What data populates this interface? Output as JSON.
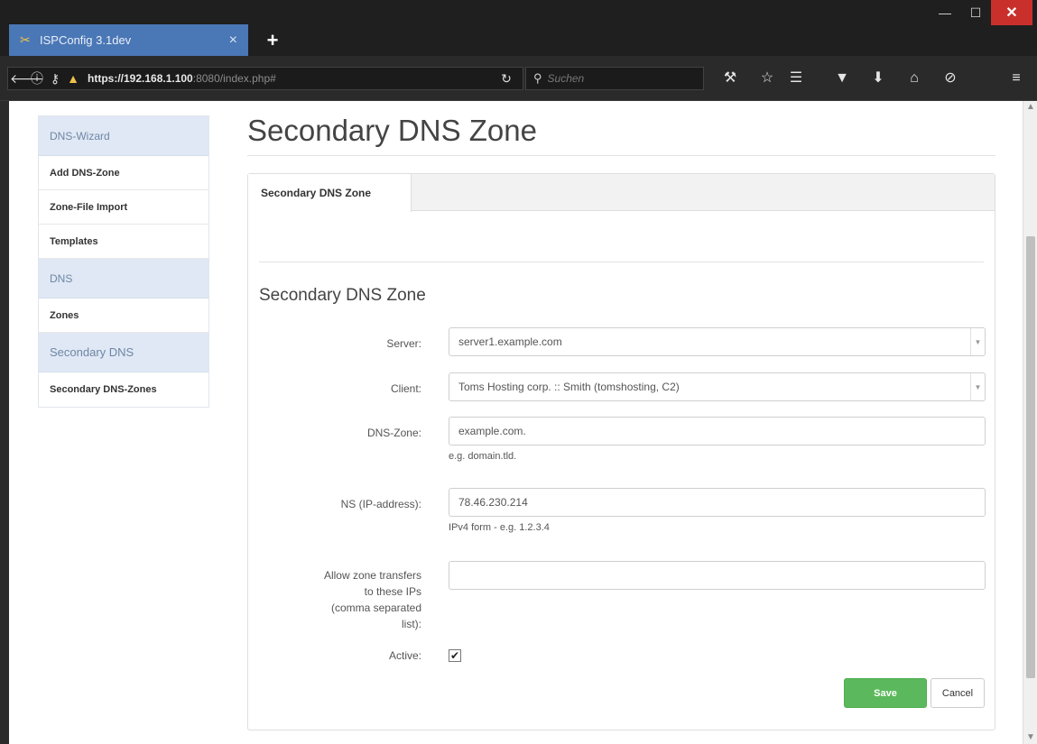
{
  "browser": {
    "tab_title": "ISPConfig 3.1dev",
    "tab_close": "×",
    "new_tab": "+",
    "url_host": "https://192.168.1.100",
    "url_rest": ":8080/index.php#",
    "search_placeholder": "Suchen",
    "window_controls": {
      "minimize": "—",
      "maximize": "☐",
      "close": "✕"
    }
  },
  "sidebar": {
    "sections": [
      {
        "header": "DNS-Wizard",
        "items": [
          "Add DNS-Zone",
          "Zone-File Import",
          "Templates"
        ]
      },
      {
        "header": "DNS",
        "items": [
          "Zones"
        ]
      },
      {
        "header": "Secondary DNS",
        "items": [
          "Secondary DNS-Zones"
        ]
      }
    ]
  },
  "main": {
    "page_title": "Secondary DNS Zone",
    "tab_label": "Secondary DNS Zone",
    "section_title": "Secondary DNS Zone",
    "form": {
      "server_label": "Server:",
      "server_value": "server1.example.com",
      "client_label": "Client:",
      "client_value": "Toms Hosting corp. :: Smith (tomshosting, C2)",
      "dnszone_label": "DNS-Zone:",
      "dnszone_value": "example.com.",
      "dnszone_hint": "e.g. domain.tld.",
      "ns_label": "NS (IP-address):",
      "ns_value": "78.46.230.214",
      "ns_hint": "IPv4 form - e.g. 1.2.3.4",
      "xfer_label": "Allow zone transfers to these IPs (comma separated list):",
      "xfer_value": "",
      "active_label": "Active:",
      "active_checked": true,
      "active_mark": "✔",
      "save_label": "Save",
      "cancel_label": "Cancel"
    }
  },
  "icons": {
    "tab": "wrench-icon",
    "back": "back-arrow-icon",
    "info": "info-icon",
    "reload": "reload-icon",
    "search": "search-icon"
  }
}
